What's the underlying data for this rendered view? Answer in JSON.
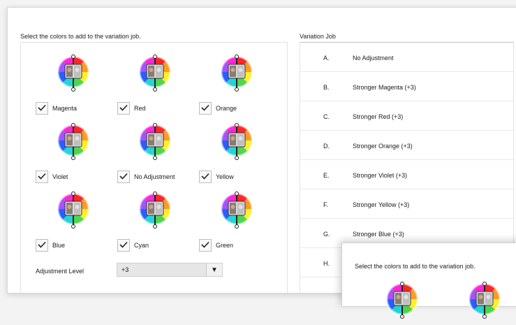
{
  "dialog": {
    "select_prompt": "Select the colors to add to the variation job.",
    "job_heading": "Variation Job"
  },
  "color_options": [
    {
      "label": "Magenta",
      "checked": true
    },
    {
      "label": "Red",
      "checked": true
    },
    {
      "label": "Orange",
      "checked": true
    },
    {
      "label": "Violet",
      "checked": true
    },
    {
      "label": "No Adjustment",
      "checked": true
    },
    {
      "label": "Yellow",
      "checked": true
    },
    {
      "label": "Blue",
      "checked": true
    },
    {
      "label": "Cyan",
      "checked": true
    },
    {
      "label": "Green",
      "checked": true
    }
  ],
  "adjustment": {
    "label": "Adjustment Level",
    "value": "+3"
  },
  "variation_job": [
    {
      "letter": "A.",
      "text": "No Adjustment"
    },
    {
      "letter": "B.",
      "text": "Stronger Magenta (+3)"
    },
    {
      "letter": "C.",
      "text": "Stronger Red (+3)"
    },
    {
      "letter": "D.",
      "text": "Stronger Orange (+3)"
    },
    {
      "letter": "E.",
      "text": "Stronger Violet (+3)"
    },
    {
      "letter": "F.",
      "text": "Stronger Yellow (+3)"
    },
    {
      "letter": "G.",
      "text": "Stronger Blue (+3)"
    },
    {
      "letter": "H.",
      "text": ""
    }
  ],
  "popup": {
    "select_prompt": "Select the colors to add to the variation job."
  },
  "icons": {
    "color_wheel": "color-wheel-face-icon",
    "check": "checkmark-icon",
    "dropdown": "dropdown-arrow-icon"
  }
}
